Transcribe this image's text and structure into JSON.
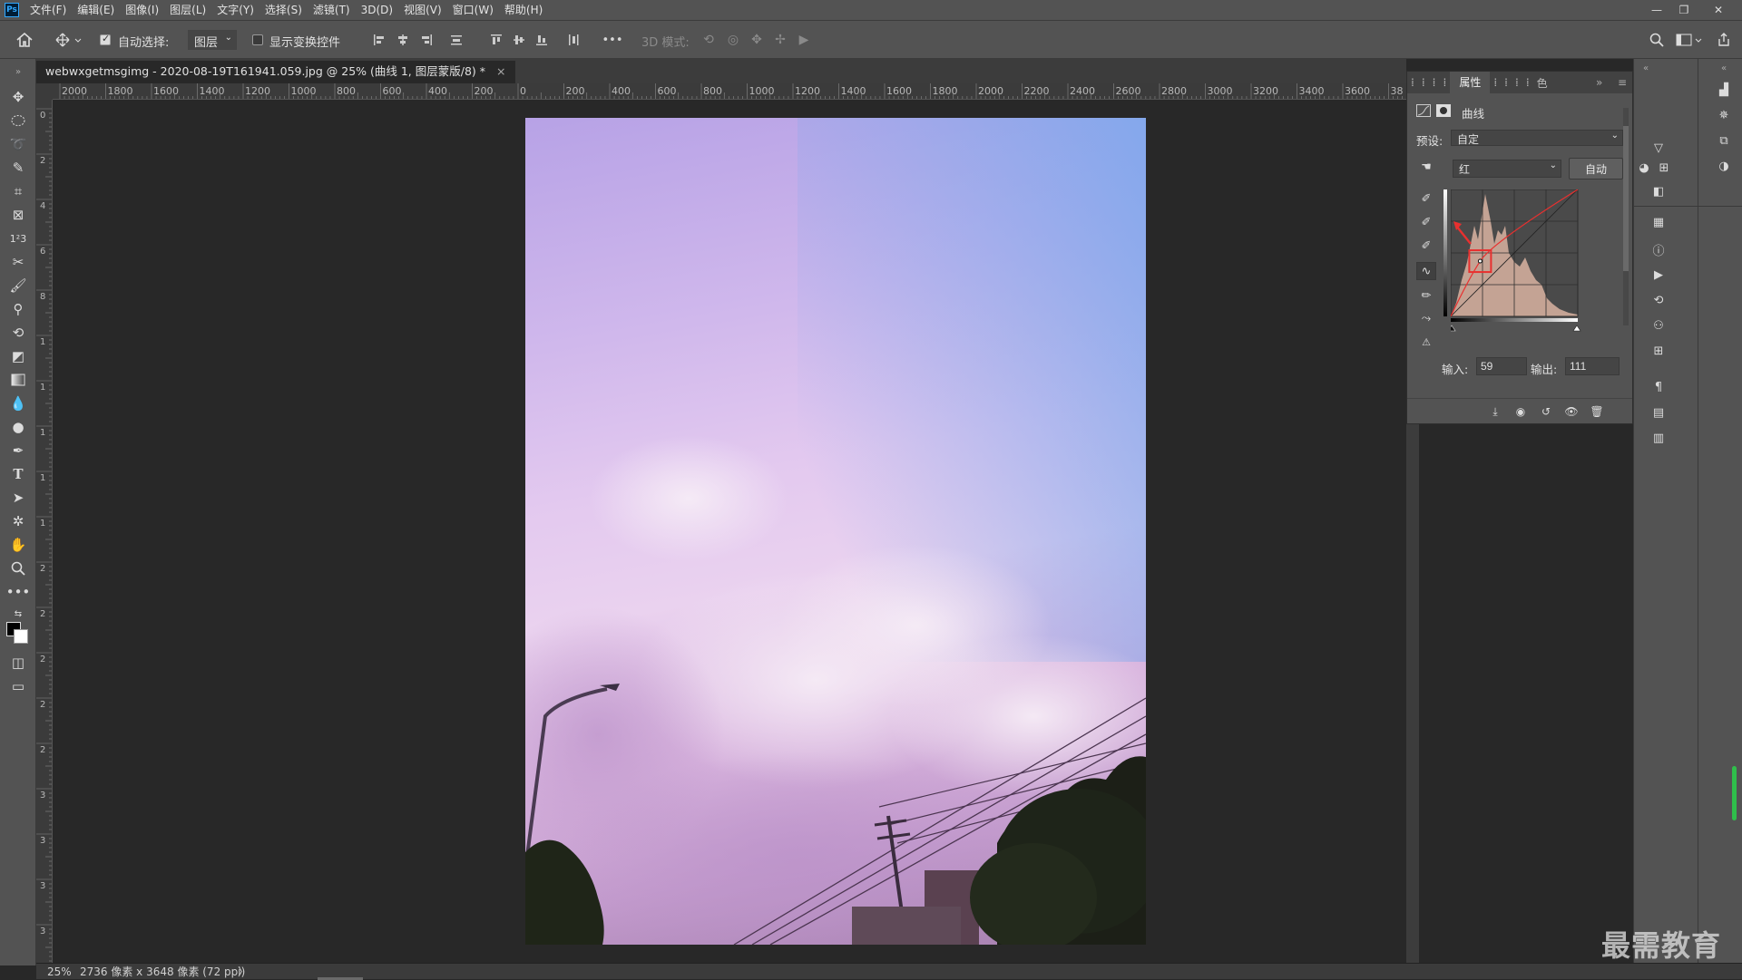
{
  "app": {
    "logo": "Ps"
  },
  "menu": [
    "文件(F)",
    "编辑(E)",
    "图像(I)",
    "图层(L)",
    "文字(Y)",
    "选择(S)",
    "滤镜(T)",
    "3D(D)",
    "视图(V)",
    "窗口(W)",
    "帮助(H)"
  ],
  "window_controls": {
    "minimize": "—",
    "restore": "❐",
    "close": "✕"
  },
  "options_bar": {
    "auto_select_label": "自动选择:",
    "auto_select_checked": true,
    "auto_select_target": "图层",
    "show_transform_label": "显示变换控件",
    "show_transform_checked": false,
    "more": "•••",
    "mode_3d_label": "3D 模式:"
  },
  "document_tab": {
    "title": "webwxgetmsgimg - 2020-08-19T161941.059.jpg @ 25% (曲线 1, 图层蒙版/8) *",
    "close": "×"
  },
  "rulers": {
    "top_labels": [
      "2000",
      "1800",
      "1600",
      "1400",
      "1200",
      "1000",
      "800",
      "600",
      "400",
      "200",
      "0",
      "200",
      "400",
      "600",
      "800",
      "1000",
      "1200",
      "1400",
      "1600",
      "1800",
      "2000",
      "2200",
      "2400",
      "2600",
      "2800",
      "3000",
      "3200",
      "3400",
      "3600",
      "38"
    ],
    "left_labels": [
      "0",
      "2",
      "4",
      "6",
      "8",
      "1",
      "1",
      "1",
      "1",
      "1",
      "2",
      "2",
      "2",
      "2",
      "2",
      "3",
      "3",
      "3",
      "3"
    ]
  },
  "properties_panel": {
    "tabs": [
      "⁞",
      "⁞",
      "⁞",
      "⁞",
      "属性",
      "⁞",
      "⁞",
      "⁞",
      "⁞",
      "色"
    ],
    "active_tab": "属性",
    "adjustment_title": "曲线",
    "preset_label": "预设:",
    "preset_value": "自定",
    "channel_value": "红",
    "auto_button": "自动",
    "input_label": "输入:",
    "input_value": "59",
    "output_label": "输出:",
    "output_value": "111",
    "curve_point": {
      "input": 59,
      "output": 111
    },
    "highlight_color": "#e8302f",
    "histogram_fill": "#c4a394"
  },
  "status_bar": {
    "zoom": "25%",
    "doc_info": "2736 像素 x 3648 像素 (72 ppi)",
    "arrow": "〉"
  },
  "watermark": "最需教育"
}
